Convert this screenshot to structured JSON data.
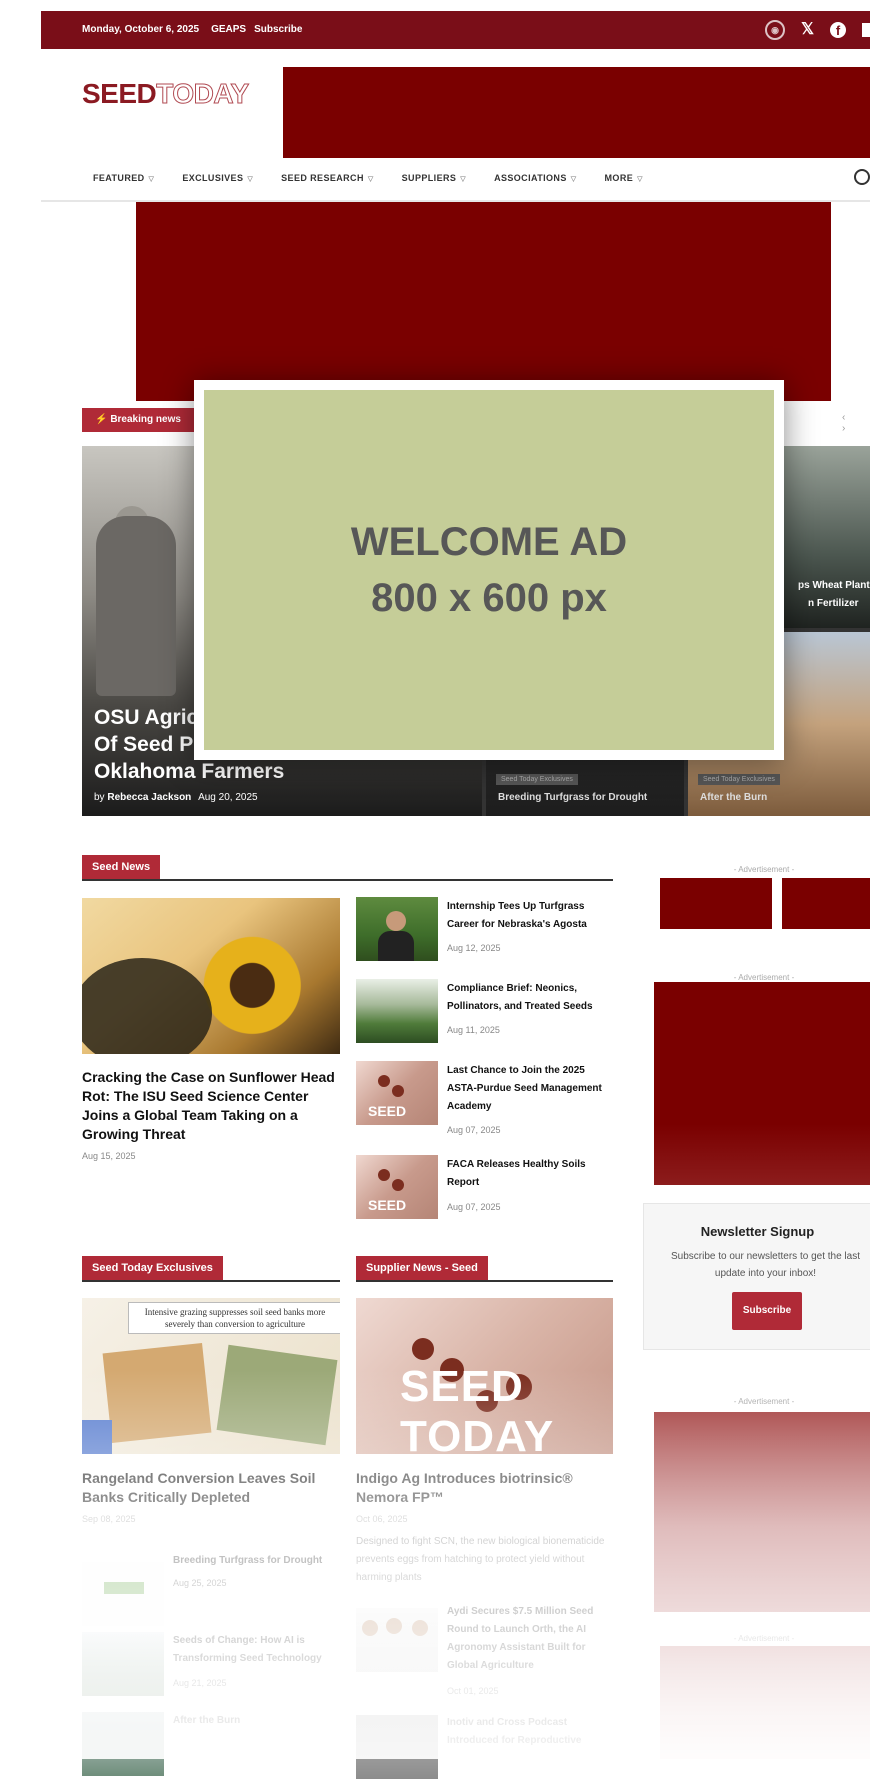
{
  "topbar": {
    "date": "Monday, October 6, 2025",
    "link1": "GEAPS",
    "link2": "Subscribe",
    "icons": [
      "rss-icon",
      "x-icon",
      "facebook-icon",
      "linkedin-icon"
    ]
  },
  "brand": {
    "seed": "SEED",
    "today": "TODAY"
  },
  "nav": {
    "items": [
      "FEATURED",
      "EXCLUSIVES",
      "SEED RESEARCH",
      "SUPPLIERS",
      "ASSOCIATIONS",
      "MORE"
    ]
  },
  "hero": {
    "breaking": "⚡ Breaking news",
    "main_title_lines": [
      "OSU Agric",
      "Of Seed P",
      "Oklahoma Farmers"
    ],
    "byline_prefix": "by",
    "author": "Rebecca Jackson",
    "date": "Aug 20, 2025",
    "cards": [
      {
        "tag": "Seed Today Exclusives",
        "title": "Breeding Turfgrass for Drought"
      },
      {
        "tag": "Seed Today Exclusives",
        "title": "After the Burn"
      },
      {
        "title_line1": "ps Wheat Plant",
        "title_line2": "n Fertilizer"
      }
    ]
  },
  "overlay": {
    "line1": "WELCOME AD",
    "line2": "800 x 600 px"
  },
  "seed_news": {
    "heading": "Seed News",
    "main_title": "Cracking the Case on Sunflower Head Rot: The ISU Seed Science Center Joins a Global Team Taking on a Growing Threat",
    "main_date": "Aug 15, 2025",
    "items": [
      {
        "title": "Internship Tees Up Turfgrass Career for Nebraska's Agosta",
        "date": "Aug 12, 2025"
      },
      {
        "title": "Compliance Brief: Neonics, Pollinators, and Treated Seeds",
        "date": "Aug 11, 2025"
      },
      {
        "title": "Last Chance to Join the 2025 ASTA-Purdue Seed Management Academy",
        "date": "Aug 07, 2025"
      },
      {
        "title": "FACA Releases Healthy Soils Report",
        "date": "Aug 07, 2025"
      }
    ],
    "thumb_text": "SEED"
  },
  "sidebar": {
    "ad_label": "- Advertisement -",
    "newsletter": {
      "title": "Newsletter Signup",
      "text": "Subscribe to our newsletters to get the last update into your inbox!",
      "button": "Subscribe"
    }
  },
  "exclusives": {
    "heading": "Seed Today Exclusives",
    "image_caption": "Intensive grazing suppresses soil seed banks more severely than conversion to agriculture",
    "main_title": "Rangeland Conversion Leaves Soil Banks Critically Depleted",
    "main_date": "Sep 08, 2025",
    "items": [
      {
        "title": "Breeding Turfgrass for Drought",
        "date": "Aug 25, 2025"
      },
      {
        "title": "Seeds of Change: How AI is Transforming Seed Technology",
        "date": "Aug 21, 2025"
      },
      {
        "title": "After the Burn"
      }
    ]
  },
  "supplier": {
    "heading": "Supplier News - Seed",
    "image_text": "SEED TODAY",
    "main_title": "Indigo Ag Introduces biotrinsic® Nemora FP™",
    "main_date": "Oct 06, 2025",
    "excerpt": "Designed to fight SCN, the new biological bionematicide prevents eggs from hatching to protect yield without harming plants",
    "items": [
      {
        "title": "Aydi Secures $7.5 Million Seed Round to Launch Orth, the AI Agronomy Assistant Built for Global Agriculture",
        "date": "Oct 01, 2025"
      },
      {
        "title": "Inotiv and Cross Podcast Introduced for Reproductive"
      }
    ]
  }
}
